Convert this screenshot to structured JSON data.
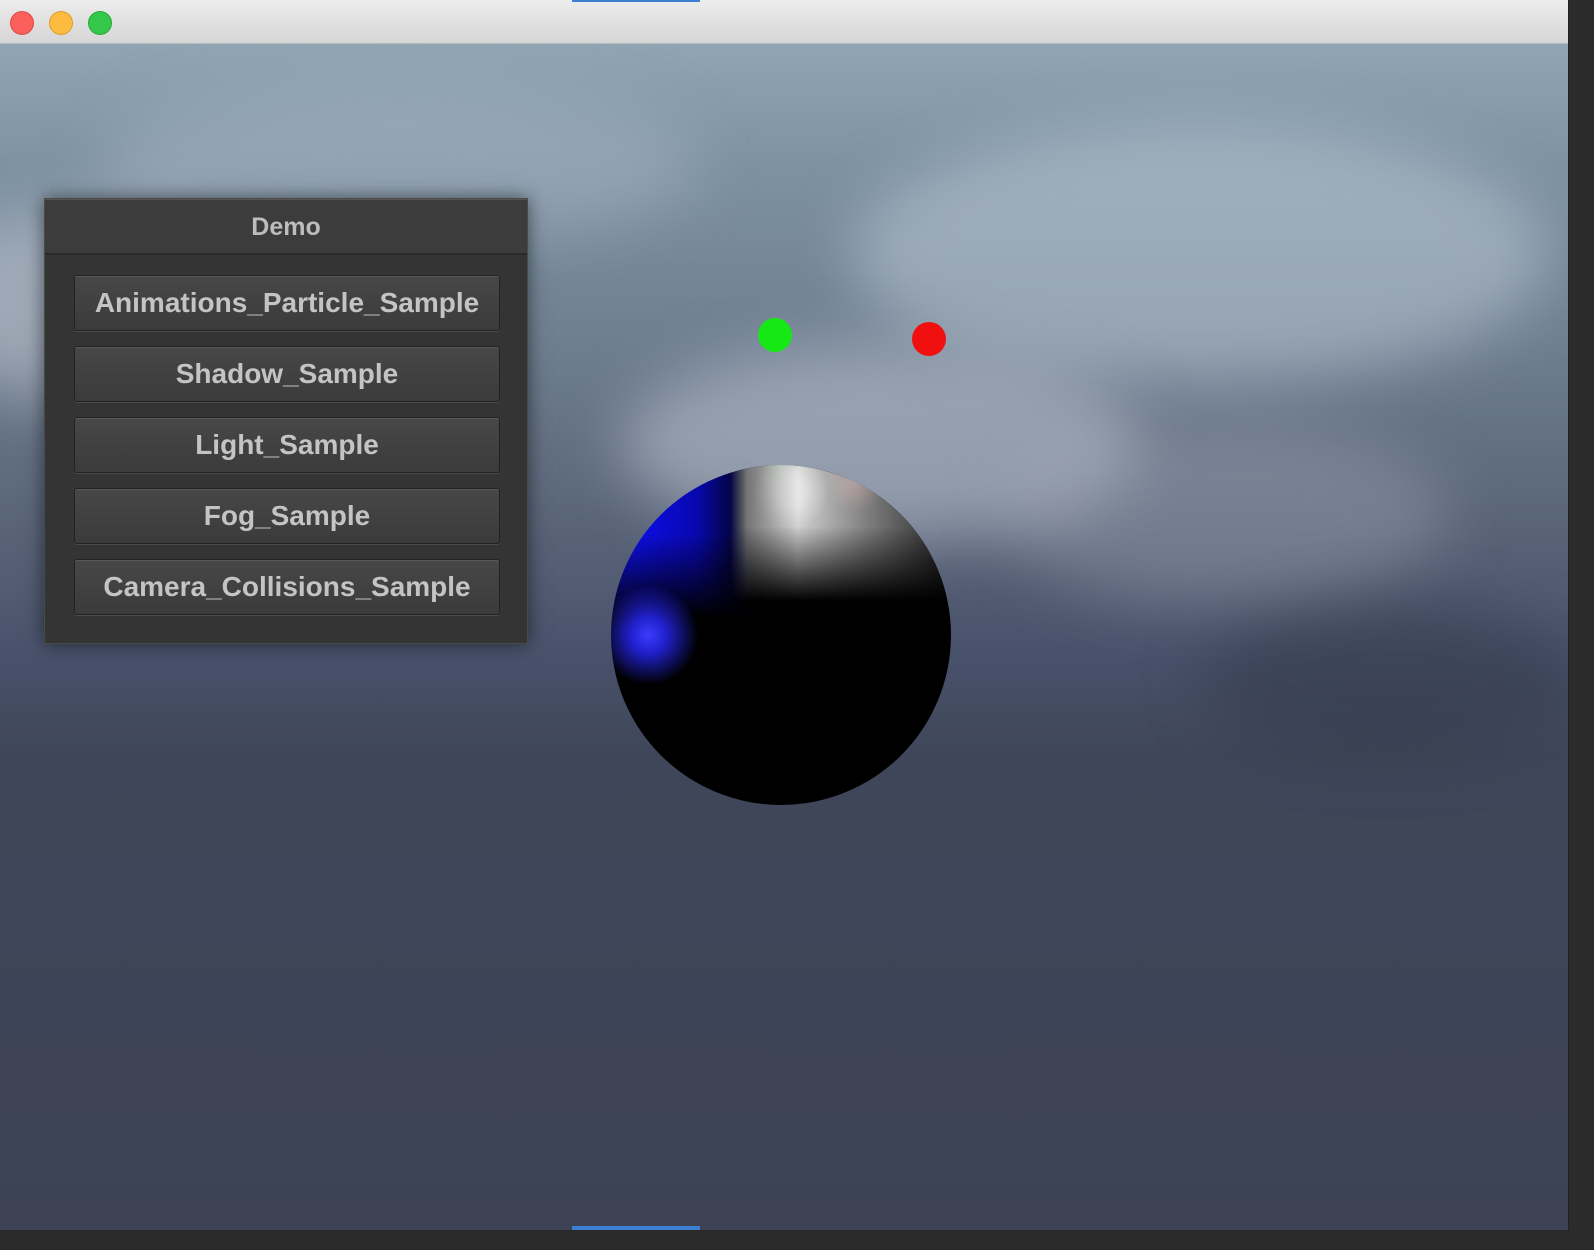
{
  "window": {
    "controls": [
      "close-icon",
      "minimize-icon",
      "maximize-icon"
    ],
    "colors": {
      "close": "#fc605b",
      "minimize": "#fdbc40",
      "maximize": "#34c84a"
    }
  },
  "scene": {
    "markers": [
      {
        "name": "green-light-marker",
        "color": "#16e816"
      },
      {
        "name": "red-light-marker",
        "color": "#f01010"
      }
    ]
  },
  "demo_panel": {
    "title": "Demo",
    "buttons": [
      {
        "label": "Animations_Particle_Sample"
      },
      {
        "label": "Shadow_Sample"
      },
      {
        "label": "Light_Sample"
      },
      {
        "label": "Fog_Sample"
      },
      {
        "label": "Camera_Collisions_Sample"
      }
    ]
  }
}
